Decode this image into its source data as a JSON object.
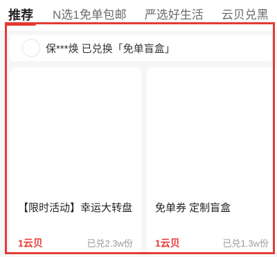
{
  "tabs": [
    {
      "label": "推荐",
      "active": true
    },
    {
      "label": "N选1免单包邮",
      "active": false
    },
    {
      "label": "严选好生活",
      "active": false
    },
    {
      "label": "云贝兑黑",
      "active": false
    }
  ],
  "notice": {
    "text": "保***焕 已兑换「免单盲盒」"
  },
  "cards": [
    {
      "title": "【限时活动】幸运大转盘",
      "price": "1云贝",
      "sold": "已兑2.3w份"
    },
    {
      "title": "免单券 定制盲盒",
      "price": "1云贝",
      "sold": "已兑1.3w份"
    }
  ],
  "colors": {
    "accent": "#e53935",
    "background": "#f6f6f6",
    "card": "#ffffff"
  }
}
